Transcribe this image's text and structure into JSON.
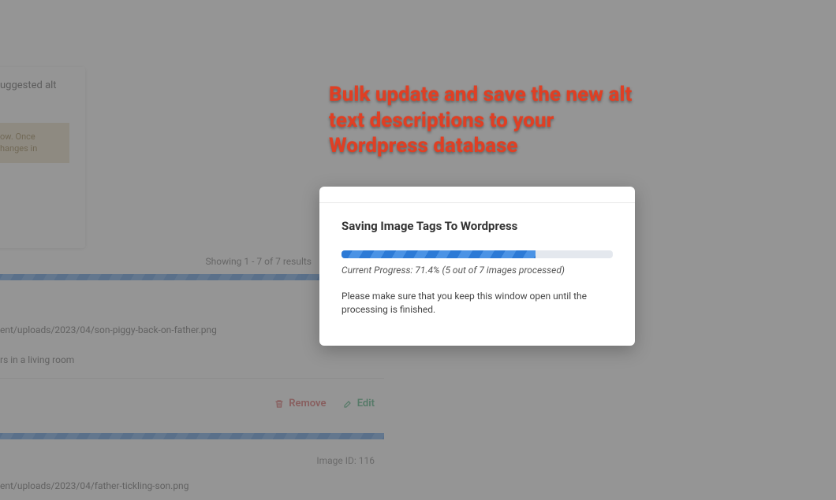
{
  "background": {
    "suggested_label": "uggested alt",
    "warn_line1": "ow. Once",
    "warn_line2": "hanges in",
    "showing": "Showing 1 - 7 of 7 results",
    "row1": {
      "path": "ent/uploads/2023/04/son-piggy-back-on-father.png",
      "alt": "rs in a living room"
    },
    "actions": {
      "remove": "Remove",
      "edit": "Edit"
    },
    "row2": {
      "image_id": "Image ID: 116",
      "path": "ent/uploads/2023/04/father-tickling-son.png"
    }
  },
  "callout": "Bulk update and save the new alt text descriptions to your Wordpress database",
  "modal": {
    "title": "Saving Image Tags To Wordpress",
    "progress_percent": 71.4,
    "progress_text": "Current Progress: 71.4% (5 out of 7 images processed)",
    "note": "Please make sure that you keep this window open until the processing is finished."
  }
}
